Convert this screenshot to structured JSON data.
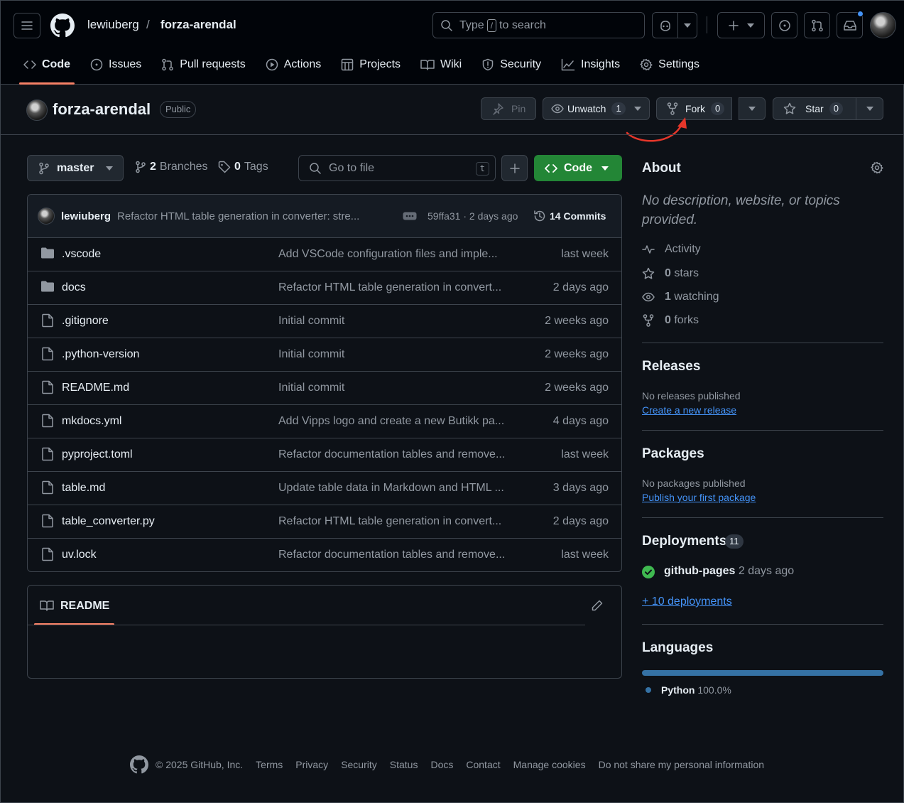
{
  "header": {
    "owner": "lewiuberg",
    "separator": "/",
    "repo": "forza-arendal",
    "search": {
      "prefix": "Type",
      "key": "/",
      "suffix": "to search"
    }
  },
  "tabs": [
    {
      "label": "Code",
      "icon": "code-icon"
    },
    {
      "label": "Issues",
      "icon": "issue-icon"
    },
    {
      "label": "Pull requests",
      "icon": "pull-request-icon"
    },
    {
      "label": "Actions",
      "icon": "play-icon"
    },
    {
      "label": "Projects",
      "icon": "table-icon"
    },
    {
      "label": "Wiki",
      "icon": "book-icon"
    },
    {
      "label": "Security",
      "icon": "shield-icon"
    },
    {
      "label": "Insights",
      "icon": "graph-icon"
    },
    {
      "label": "Settings",
      "icon": "gear-icon"
    }
  ],
  "repo_head": {
    "title": "forza-arendal",
    "visibility": "Public",
    "pin": "Pin",
    "unwatch": "Unwatch",
    "watch_count": "1",
    "fork": "Fork",
    "fork_count": "0",
    "star": "Star",
    "star_count": "0"
  },
  "toolbar": {
    "branch": "master",
    "branches_count": "2",
    "branches_label": "Branches",
    "tags_count": "0",
    "tags_label": "Tags",
    "goto_placeholder": "Go to file",
    "goto_key": "t",
    "code": "Code"
  },
  "commit": {
    "author": "lewiuberg",
    "message": "Refactor HTML table generation in converter: stre...",
    "hash_time": "59ffa31 · 2 days ago",
    "commits": "14 Commits"
  },
  "files": [
    {
      "type": "dir",
      "name": ".vscode",
      "message": "Add VSCode configuration files and imple...",
      "age": "last week"
    },
    {
      "type": "dir",
      "name": "docs",
      "message": "Refactor HTML table generation in convert...",
      "age": "2 days ago"
    },
    {
      "type": "file",
      "name": ".gitignore",
      "message": "Initial commit",
      "age": "2 weeks ago"
    },
    {
      "type": "file",
      "name": ".python-version",
      "message": "Initial commit",
      "age": "2 weeks ago"
    },
    {
      "type": "file",
      "name": "README.md",
      "message": "Initial commit",
      "age": "2 weeks ago"
    },
    {
      "type": "file",
      "name": "mkdocs.yml",
      "message": "Add Vipps logo and create a new Butikk pa...",
      "age": "4 days ago"
    },
    {
      "type": "file",
      "name": "pyproject.toml",
      "message": "Refactor documentation tables and remove...",
      "age": "last week"
    },
    {
      "type": "file",
      "name": "table.md",
      "message": "Update table data in Markdown and HTML ...",
      "age": "3 days ago"
    },
    {
      "type": "file",
      "name": "table_converter.py",
      "message": "Refactor HTML table generation in convert...",
      "age": "2 days ago"
    },
    {
      "type": "file",
      "name": "uv.lock",
      "message": "Refactor documentation tables and remove...",
      "age": "last week"
    }
  ],
  "readme": {
    "label": "README"
  },
  "about": {
    "title": "About",
    "description": "No description, website, or topics provided.",
    "activity": "Activity",
    "stars_count": "0",
    "stars_label": "stars",
    "watching_count": "1",
    "watching_label": "watching",
    "forks_count": "0",
    "forks_label": "forks"
  },
  "releases": {
    "title": "Releases",
    "none": "No releases published",
    "link": "Create a new release"
  },
  "packages": {
    "title": "Packages",
    "none": "No packages published",
    "link": "Publish your first package"
  },
  "deployments": {
    "title": "Deployments",
    "count": "11",
    "env": "github-pages",
    "age": "2 days ago",
    "more": "+ 10 deployments"
  },
  "languages": {
    "title": "Languages",
    "name": "Python",
    "percent": "100.0%",
    "fill": 1.0,
    "color": "#3572A5"
  },
  "footer": {
    "copyright": "© 2025 GitHub, Inc.",
    "links": [
      "Terms",
      "Privacy",
      "Security",
      "Status",
      "Docs",
      "Contact",
      "Manage cookies",
      "Do not share my personal information"
    ]
  },
  "colors": {
    "accent": "#f78166",
    "green": "#238636",
    "link": "#4493f8",
    "annotation_arrow": "#e5362a"
  }
}
